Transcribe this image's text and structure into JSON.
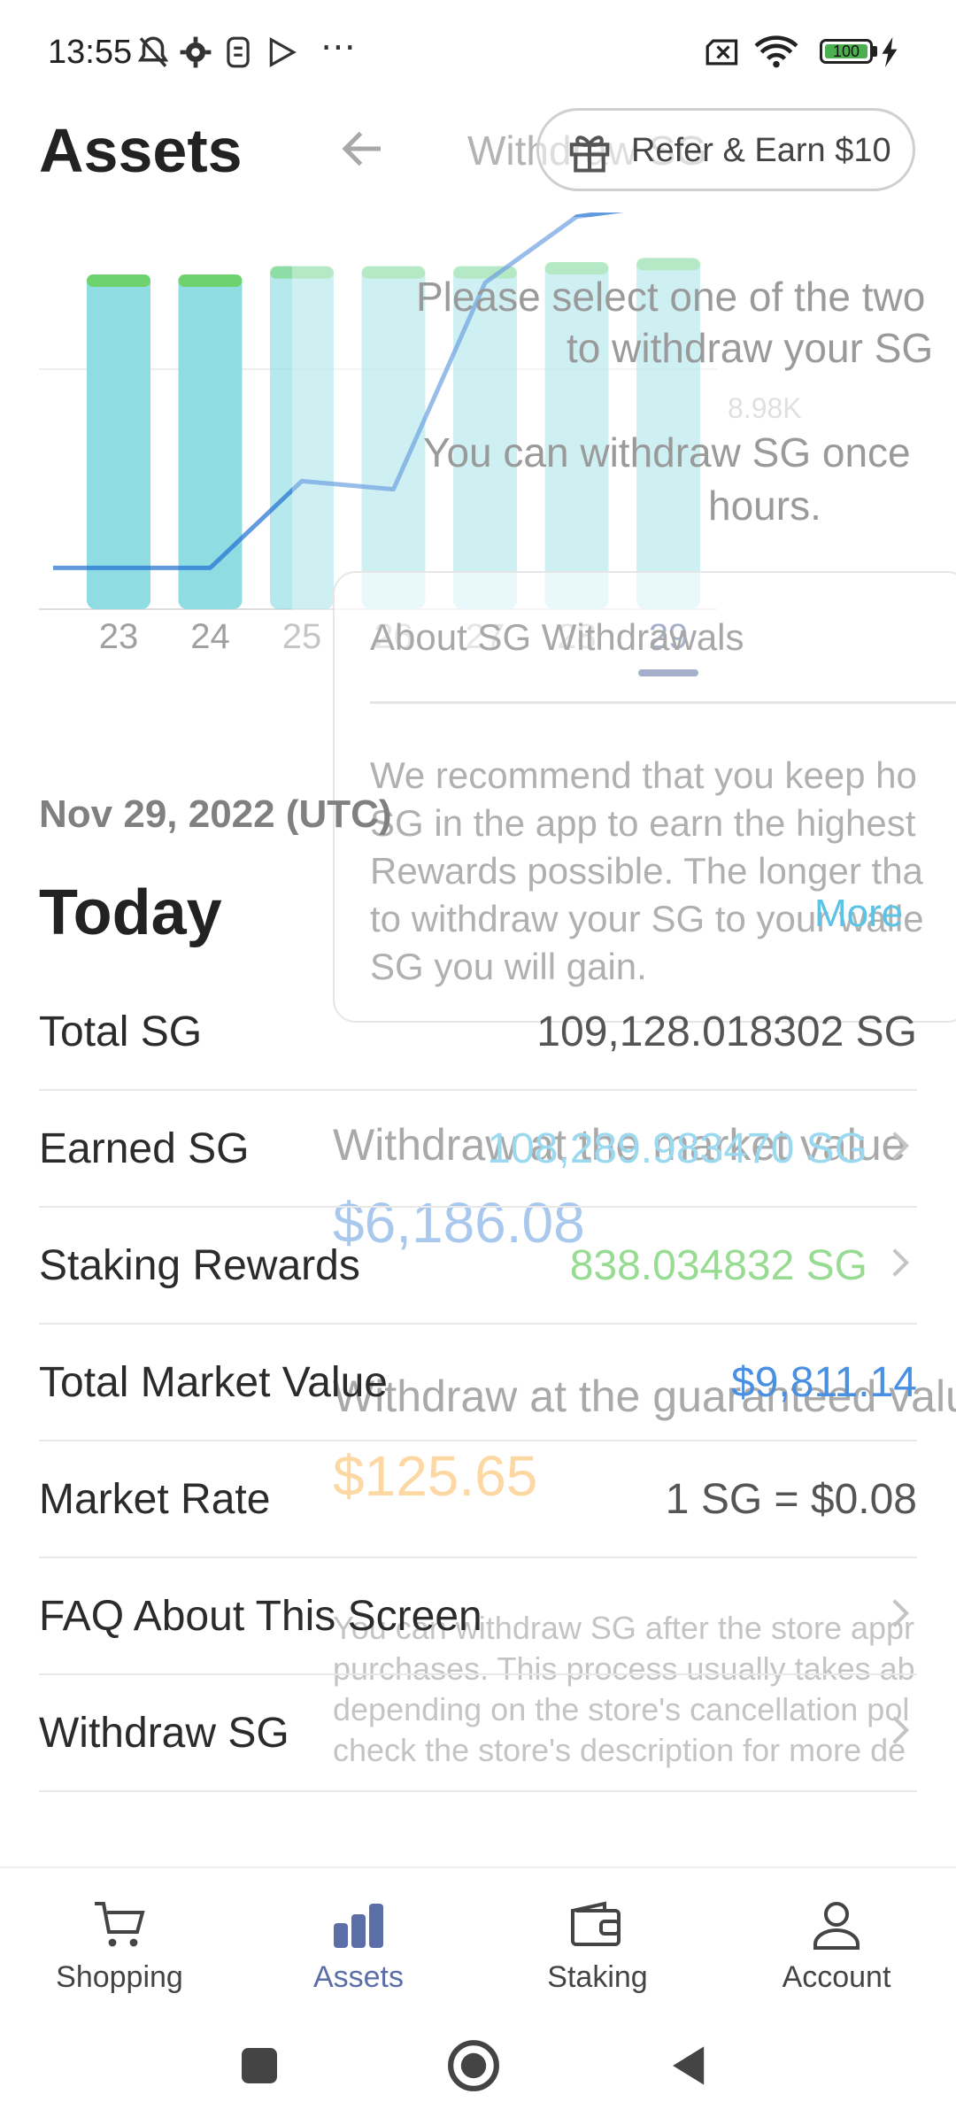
{
  "status_bar": {
    "time": "13:55",
    "battery": "100",
    "icons": [
      "bell-off-icon",
      "gear-icon",
      "sim-icon",
      "play-store-icon",
      "more-dots-icon",
      "no-sim-icon",
      "wifi-icon",
      "battery-icon",
      "charging-icon"
    ]
  },
  "header": {
    "title": "Assets",
    "overlay_title": "Withdraw SG",
    "refer_label": "Refer & Earn $10"
  },
  "chart_data": {
    "type": "bar",
    "categories": [
      "23",
      "24",
      "25",
      "26",
      "27",
      "28",
      "29"
    ],
    "selected_category": "29",
    "value_label": "8.98K",
    "series": [
      {
        "values": [
          8.1,
          8.1,
          8.3,
          8.3,
          8.3,
          8.4,
          8.5
        ]
      },
      {
        "values": [
          1.0,
          1.0,
          3.1,
          2.9,
          7.9,
          9.5,
          9.8
        ]
      }
    ],
    "colors": {
      "bar": "#8fdde3",
      "bar_cap": "#6ed36e",
      "line": "#1f6fd1",
      "selected_tick": "#3b4f8c"
    }
  },
  "overlay": {
    "lines": [
      "Please select one of the two",
      "to withdraw your SG",
      "You can withdraw SG once",
      "hours."
    ],
    "card_title": "About SG Withdrawals",
    "card_body": [
      "We recommend that you keep ho",
      "SG in the app to earn the highest",
      "Rewards possible. The longer tha",
      "to withdraw your SG to your walle",
      "SG you will gain."
    ],
    "more": "More",
    "withdraw_market": "Withdraw at the market value",
    "market_amount": "$6,186.08",
    "withdraw_guaranteed": "Withdraw at the guaranteed valu",
    "guaranteed_amount": "$125.65",
    "small_lines": [
      "You can withdraw SG after the store appr",
      "purchases. This process usually takes ab",
      "depending on the store's cancellation pol",
      "check the store's description for more de"
    ]
  },
  "summary": {
    "date": "Nov 29, 2022 (UTC)",
    "heading": "Today"
  },
  "rows": [
    {
      "label": "Total SG",
      "value": "109,128.018302 SG",
      "color": "#555555",
      "chevron": false
    },
    {
      "label": "Earned SG",
      "value": "108,289.983470 SG",
      "color": "#9ad9f0",
      "chevron": true
    },
    {
      "label": "Staking Rewards",
      "value": "838.034832 SG",
      "color": "#98dc93",
      "chevron": true
    },
    {
      "label": "Total Market Value",
      "value": "$9,811.14",
      "color": "#4a90e2",
      "chevron": false
    },
    {
      "label": "Market Rate",
      "value": "1 SG = $0.08",
      "color": "#555555",
      "chevron": false
    },
    {
      "label": "FAQ About This Screen",
      "value": "",
      "color": "#555555",
      "chevron": true
    },
    {
      "label": "Withdraw SG",
      "value": "",
      "color": "#555555",
      "chevron": true
    }
  ],
  "bottom_nav": [
    {
      "label": "Shopping",
      "icon": "cart-icon",
      "active": false
    },
    {
      "label": "Assets",
      "icon": "bar-chart-icon",
      "active": true
    },
    {
      "label": "Staking",
      "icon": "wallet-icon",
      "active": false
    },
    {
      "label": "Account",
      "icon": "person-icon",
      "active": false
    }
  ],
  "colors": {
    "accent": "#5b6ea8",
    "text": "#2b2b2b"
  }
}
